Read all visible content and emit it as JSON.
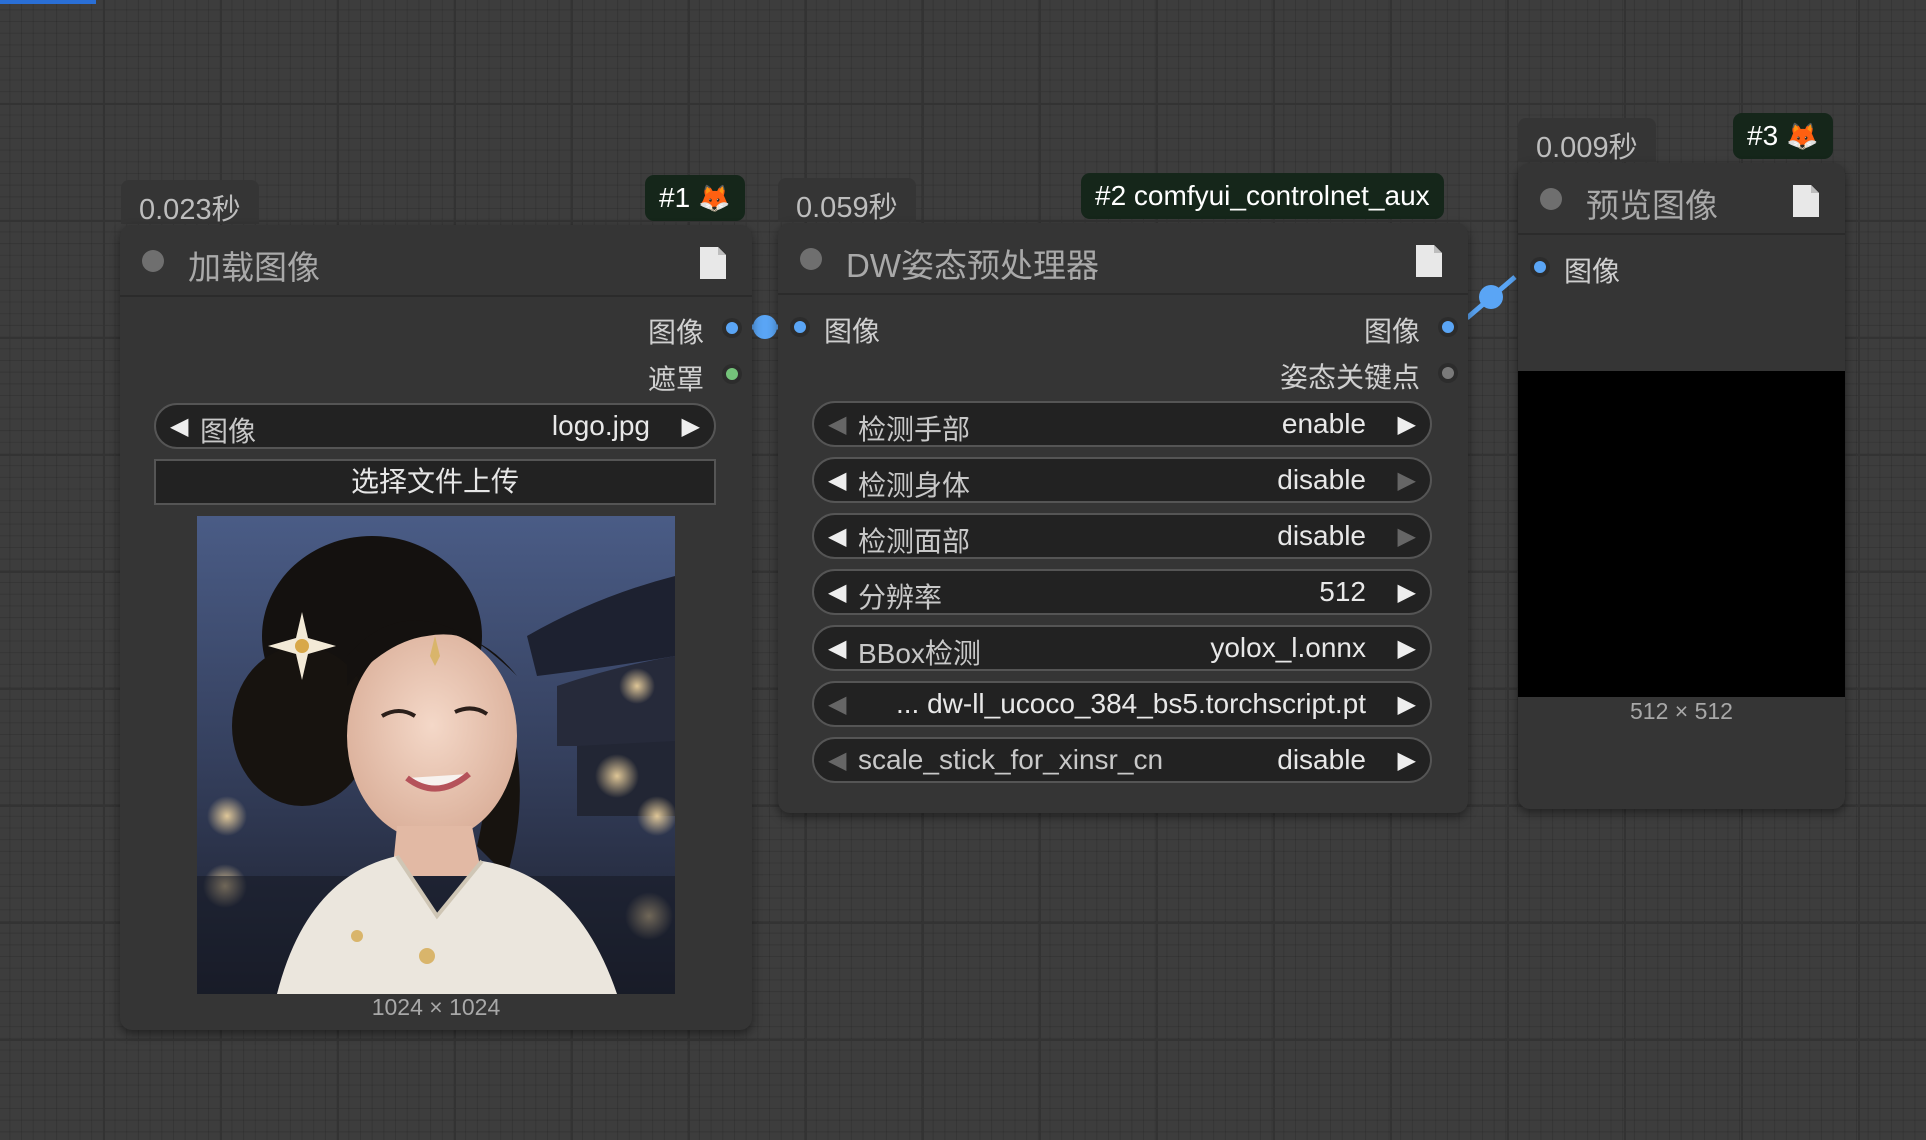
{
  "nodes": {
    "load_image": {
      "timing": "0.023秒",
      "badge": "#1",
      "title": "加载图像",
      "outputs": [
        "图像",
        "遮罩"
      ],
      "image_widget": {
        "label": "图像",
        "value": "logo.jpg"
      },
      "upload_button": "选择文件上传",
      "image_size": "1024 × 1024"
    },
    "dw_preprocessor": {
      "timing": "0.059秒",
      "badge": "#2 comfyui_controlnet_aux",
      "title": "DW姿态预处理器",
      "input": "图像",
      "outputs": [
        "图像",
        "姿态关键点"
      ],
      "widgets": [
        {
          "label": "检测手部",
          "value": "enable"
        },
        {
          "label": "检测身体",
          "value": "disable"
        },
        {
          "label": "检测面部",
          "value": "disable"
        },
        {
          "label": "分辨率",
          "value": "512"
        },
        {
          "label": "BBox检测",
          "value": "yolox_l.onnx"
        },
        {
          "label": "",
          "value": "... dw-ll_ucoco_384_bs5.torchscript.pt"
        },
        {
          "label": "scale_stick_for_xinsr_cn",
          "value": "disable"
        }
      ]
    },
    "preview_image": {
      "timing": "0.009秒",
      "badge": "#3",
      "title": "预览图像",
      "input": "图像",
      "image_size": "512 × 512"
    }
  },
  "colors": {
    "canvas": "#3d3d3d",
    "node_bg": "#353535",
    "image_socket": "#5aa5f5",
    "mask_socket": "#74c37a",
    "badge_bg": "#15261a"
  },
  "icons": [
    "fox-icon",
    "document-icon",
    "triangle-left-icon",
    "triangle-right-icon"
  ]
}
